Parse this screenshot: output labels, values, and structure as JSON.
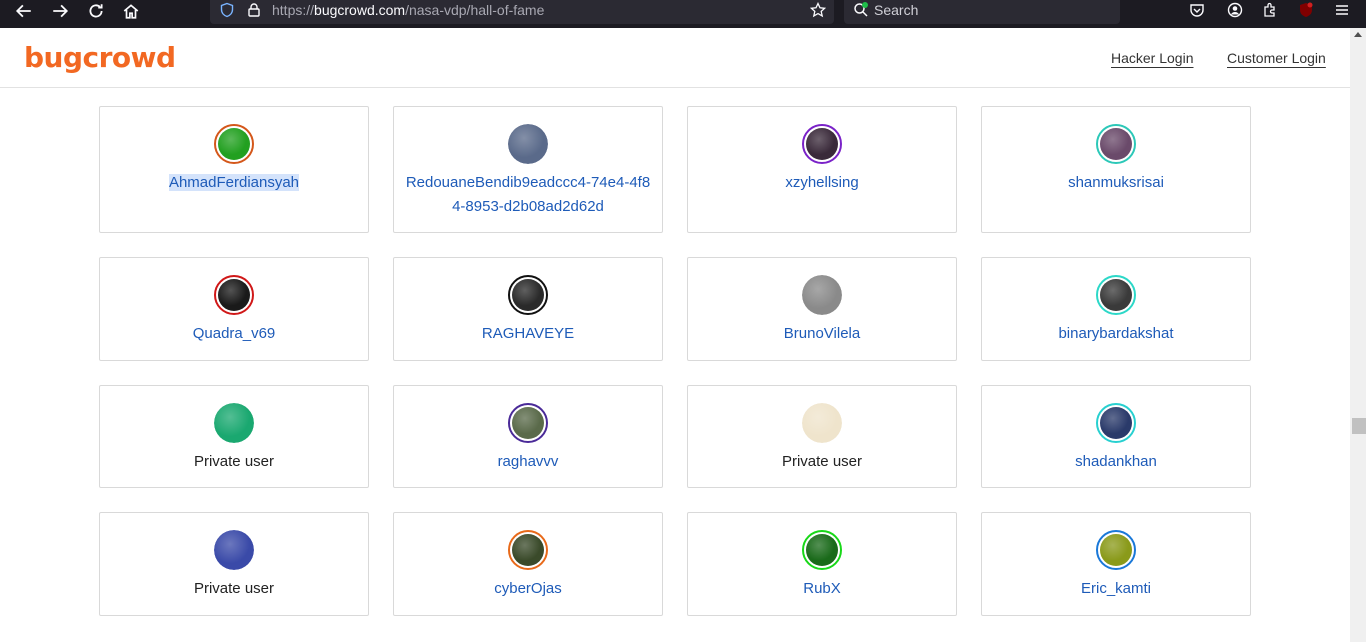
{
  "browser": {
    "url_prefix": "https://",
    "url_host": "bugcrowd.com",
    "url_path": "/nasa-vdp/hall-of-fame",
    "search_placeholder": "Search"
  },
  "header": {
    "logo": "bugcrowd",
    "hacker_login": "Hacker Login",
    "customer_login": "Customer Login"
  },
  "colors": {
    "brand": "#f26822",
    "link": "#1e5bb8"
  },
  "hackers": [
    {
      "name": "AhmadFerdiansyah",
      "private": false,
      "ring": "#d4571a",
      "fill": "#22a020"
    },
    {
      "name": "RedouaneBendib9eadccc4-74e4-4f84-8953-d2b08ad2d62d",
      "private": false,
      "ring": "",
      "fill": "#5a6a8a"
    },
    {
      "name": "xzyhellsing",
      "private": false,
      "ring": "#7a22c8",
      "fill": "#3a2a3a"
    },
    {
      "name": "shanmuksrisai",
      "private": false,
      "ring": "#2cc8b8",
      "fill": "#6a4a6a"
    },
    {
      "name": "Quadra_v69",
      "private": false,
      "ring": "#d01818",
      "fill": "#1a1a1a"
    },
    {
      "name": "RAGHAVEYE",
      "private": false,
      "ring": "#111111",
      "fill": "#2a2a2a"
    },
    {
      "name": "BrunoVilela",
      "private": false,
      "ring": "",
      "fill": "#8a8a8a"
    },
    {
      "name": "binarybardakshat",
      "private": false,
      "ring": "#2cd8c8",
      "fill": "#3a3a3a"
    },
    {
      "name": "Private user",
      "private": true,
      "ring": "",
      "fill": "#1aa870"
    },
    {
      "name": "raghavvv",
      "private": false,
      "ring": "#4a2a98",
      "fill": "#5a6a4a"
    },
    {
      "name": "Private user",
      "private": true,
      "ring": "",
      "fill": "#efe4cc"
    },
    {
      "name": "shadankhan",
      "private": false,
      "ring": "#28d0d0",
      "fill": "#2a3a6a"
    },
    {
      "name": "Private user",
      "private": true,
      "ring": "",
      "fill": "#3a4aa8"
    },
    {
      "name": "cyberOjas",
      "private": false,
      "ring": "#e86a1a",
      "fill": "#3a4a2a"
    },
    {
      "name": "RubX",
      "private": false,
      "ring": "#18d818",
      "fill": "#1a6a1a"
    },
    {
      "name": "Eric_kamti",
      "private": false,
      "ring": "#1a78d8",
      "fill": "#8a9a1a"
    }
  ]
}
